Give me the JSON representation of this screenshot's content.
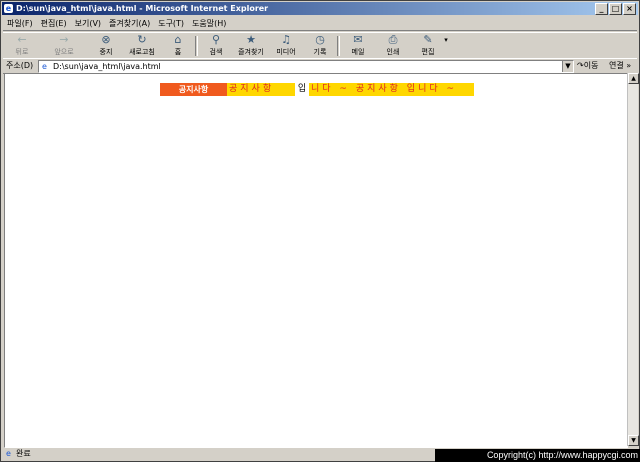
{
  "window": {
    "title": "D:\\sun\\java_html\\java.html - Microsoft Internet Explorer",
    "controls": [
      "_",
      "□",
      "×"
    ]
  },
  "menu": [
    "파일(F)",
    "편집(E)",
    "보기(V)",
    "즐겨찾기(A)",
    "도구(T)",
    "도움말(H)"
  ],
  "toolbar": {
    "back": "뒤로",
    "forward": "앞으로",
    "stop": "중지",
    "refresh": "새로고침",
    "home": "홈",
    "search": "검색",
    "favorites": "즐겨찾기",
    "media": "미디어",
    "history": "기록",
    "mail": "메일",
    "print": "인쇄",
    "edit": "편집"
  },
  "address": {
    "label": "주소(D)",
    "url": "D:\\sun\\java_html\\java.html",
    "go": "이동",
    "links": "연결 »"
  },
  "content": {
    "badge": "공지사항",
    "marquee_1": "공지사항",
    "gap_text": "입",
    "marquee_2": "니다 ~ 공지사항  입니다 ~",
    "colors": {
      "badge": "#f05a1e",
      "marquee_bg": "#ffd700",
      "marquee_text": "#dd2222"
    }
  },
  "status": {
    "text": "완료"
  },
  "copyright": "Copyright(c) http://www.happycgi.com"
}
